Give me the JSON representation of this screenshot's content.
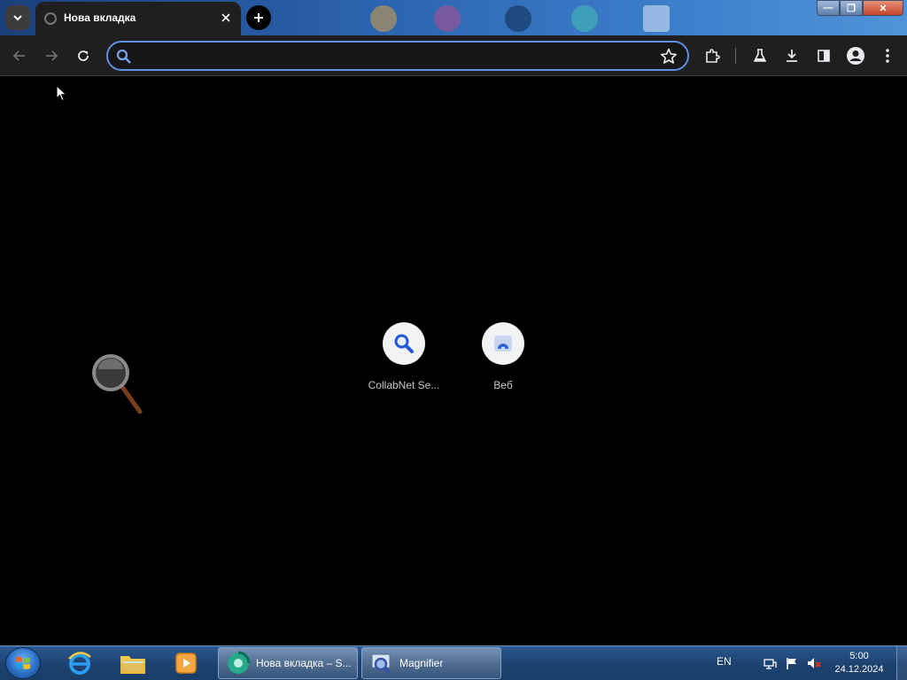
{
  "browser": {
    "tab": {
      "title": "Нова вкладка"
    },
    "omnibox": {
      "value": "",
      "placeholder": ""
    }
  },
  "window_controls": {
    "minimize": "—",
    "maximize": "❐",
    "close": "✕"
  },
  "new_tab_page": {
    "shortcuts": [
      {
        "label": "CollabNet Se...",
        "icon": "magnifier-icon"
      },
      {
        "label": "Веб",
        "icon": "web-icon"
      }
    ]
  },
  "taskbar": {
    "tasks": [
      {
        "label": "Нова вкладка – S...",
        "icon": "browser-app-icon"
      },
      {
        "label": "Magnifier",
        "icon": "magnifier-app-icon"
      }
    ],
    "tray": {
      "language": "EN",
      "hidden_icons_arrow": "",
      "time": "5:00",
      "date": "24.12.2024"
    }
  },
  "colors": {
    "accent": "#5f8ee8",
    "toolbar": "#1f1f1f",
    "page_background": "#000000",
    "taskbar": "#1c426f"
  }
}
